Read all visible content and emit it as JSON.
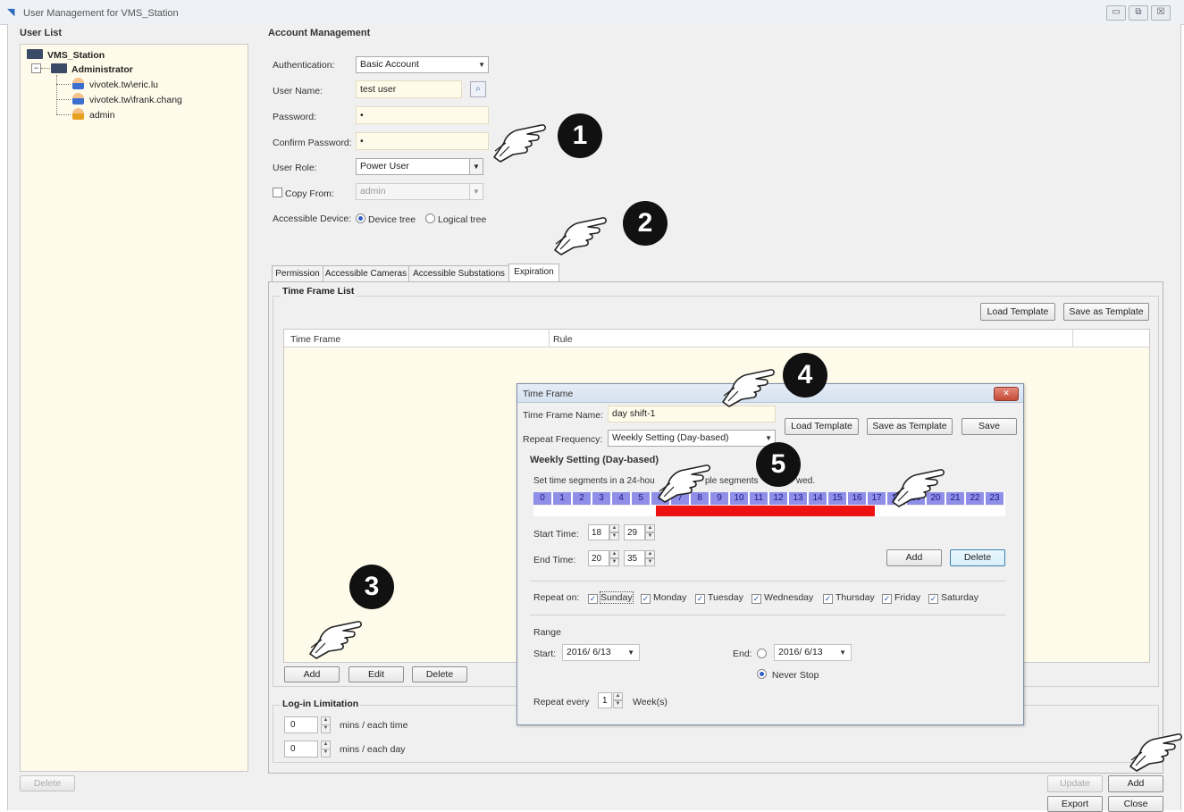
{
  "window": {
    "title": "User Management for VMS_Station",
    "controls": [
      "minimize-icon",
      "restore-icon",
      "close-icon"
    ]
  },
  "user_list": {
    "title": "User List",
    "root": "VMS_Station",
    "group": "Administrator",
    "users": [
      "vivotek.tw\\eric.lu",
      "vivotek.tw\\frank.chang",
      "admin"
    ],
    "delete_label": "Delete"
  },
  "account": {
    "title": "Account Management",
    "authentication_label": "Authentication:",
    "authentication_value": "Basic Account",
    "username_label": "User Name:",
    "username_value": "test user",
    "password_label": "Password:",
    "password_value": "•",
    "confirm_label": "Confirm Password:",
    "confirm_value": "•",
    "role_label": "User Role:",
    "role_value": "Power User",
    "copy_from_label": "Copy From:",
    "copy_from_value": "admin",
    "device_label": "Accessible Device:",
    "device_tree_label": "Device tree",
    "logical_tree_label": "Logical tree"
  },
  "tabs": [
    "Permission",
    "Accessible Cameras",
    "Accessible Substations",
    "Expiration"
  ],
  "time_frame_list": {
    "title": "Time Frame List",
    "load_template": "Load Template",
    "save_as_template": "Save as Template",
    "col_time_frame": "Time Frame",
    "col_rule": "Rule",
    "add": "Add",
    "edit": "Edit",
    "delete": "Delete"
  },
  "login_limit": {
    "title": "Log-in Limitation",
    "each_time_value": "0",
    "each_time_unit": "mins  /  each time",
    "each_day_value": "0",
    "each_day_unit": "mins  /  each day"
  },
  "footer": {
    "update": "Update",
    "add": "Add",
    "export": "Export",
    "close": "Close"
  },
  "dialog": {
    "title": "Time Frame",
    "name_label": "Time Frame Name:",
    "name_value": "day shift-1",
    "frequency_label": "Repeat Frequency:",
    "frequency_value": "Weekly Setting (Day-based)",
    "load_template": "Load Template",
    "save_as_template": "Save as Template",
    "save": "Save",
    "section_title": "Weekly Setting (Day-based)",
    "hint_left": "Set time segments in a 24-hou",
    "hint_right": "ple segments",
    "hint_end": "wed.",
    "hours": [
      "0",
      "1",
      "2",
      "3",
      "4",
      "5",
      "6",
      "7",
      "8",
      "9",
      "10",
      "11",
      "12",
      "13",
      "14",
      "15",
      "16",
      "17",
      "18",
      "19",
      "20",
      "21",
      "22",
      "23"
    ],
    "selected_range": [
      6,
      17
    ],
    "selection_color": "#ee1111",
    "start_time_label": "Start Time:",
    "start_hour": "18",
    "start_min": "29",
    "end_time_label": "End Time:",
    "end_hour": "20",
    "end_min": "35",
    "add": "Add",
    "delete": "Delete",
    "repeat_on_label": "Repeat on:",
    "days": [
      "Sunday",
      "Monday",
      "Tuesday",
      "Wednesday",
      "Thursday",
      "Friday",
      "Saturday"
    ],
    "range_label": "Range",
    "start_label": "Start:",
    "start_date": "2016/ 6/13",
    "end_label": "End:",
    "end_date": "2016/ 6/13",
    "never_stop": "Never Stop",
    "repeat_every_label": "Repeat every",
    "repeat_every_value": "1",
    "repeat_every_unit": "Week(s)"
  },
  "annotations": {
    "steps": [
      "1",
      "2",
      "3",
      "4",
      "5"
    ],
    "pointer_icon": "pointing-hand-icon"
  }
}
